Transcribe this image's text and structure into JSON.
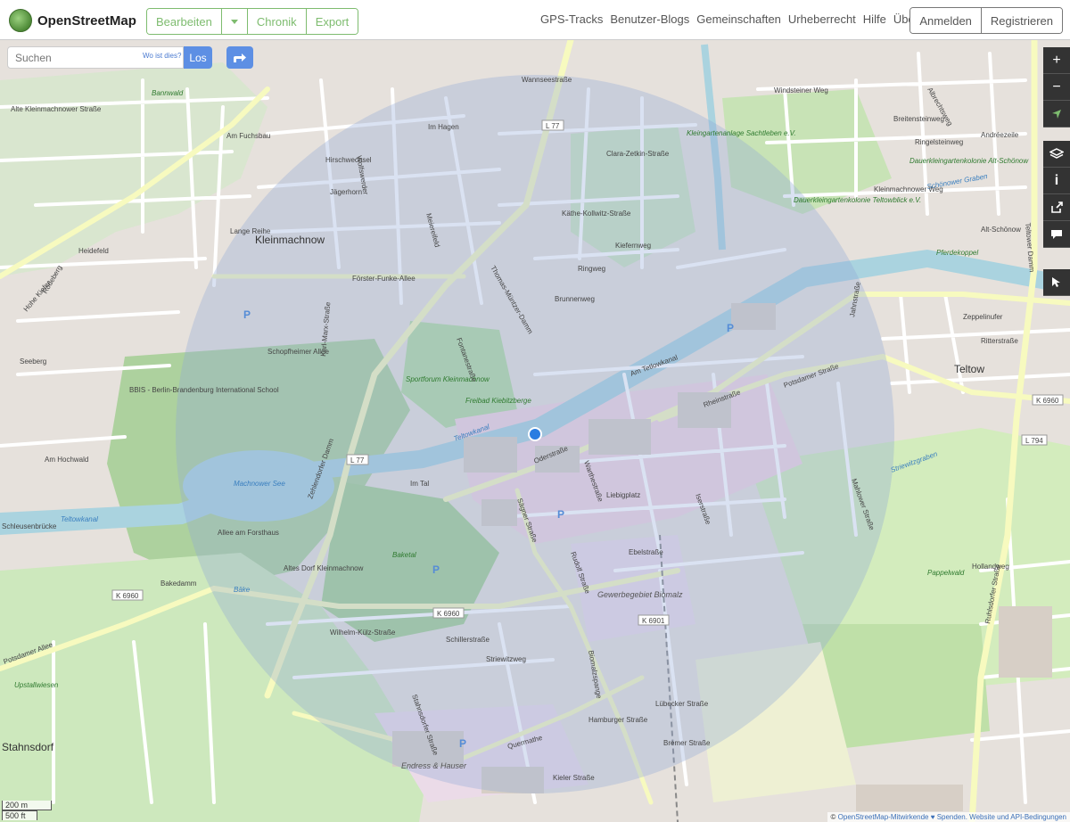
{
  "brand": {
    "name": "OpenStreetMap"
  },
  "edit": {
    "bearbeiten": "Bearbeiten",
    "chronik": "Chronik",
    "export": "Export"
  },
  "nav": [
    "GPS-Tracks",
    "Benutzer-Blogs",
    "Gemeinschaften",
    "Urheberrecht",
    "Hilfe",
    "Über"
  ],
  "auth": {
    "login": "Anmelden",
    "register": "Registrieren"
  },
  "search": {
    "placeholder": "Suchen",
    "where": "Wo ist dies?",
    "go": "Los"
  },
  "scale": {
    "metric": "200 m",
    "imperial": "500 ft"
  },
  "attribution": {
    "copy": "© ",
    "contributors": "OpenStreetMap-Mitwirkende",
    "tail": " ♥ Spenden. Website und API-Bedingungen"
  },
  "controls": [
    "zoom-in",
    "zoom-out",
    "locate",
    "layers",
    "info",
    "share",
    "note",
    "query"
  ],
  "colors": {
    "accent_green": "#7ebc6f",
    "blue": "#5d8fe4",
    "accuracy_circle": "#8ea6d8"
  },
  "map_labels": {
    "towns": [
      "Kleinmachnow",
      "Teltow",
      "Stahnsdorf"
    ],
    "places": [
      "Liebigplatz",
      "Altes Dorf Kleinmachnow",
      "Machnower See",
      "Baketal",
      "Sportforum Kleinmachnow",
      "Freibad Kiebitzberge",
      "BBIS - Berlin-Brandenburg International School",
      "Gewerbegebiet Biomalz",
      "Endress & Hauser",
      "Upstallwiesen",
      "Bannwald",
      "Pappelwald",
      "Schleusenbrücke",
      "Kleingartenanlage Sachtleben e.V.",
      "Dauerkleingartenkolonie Alt-Schönow",
      "Dauerkleingartenkolonie Teltowblick e.V.",
      "Pferdekoppel",
      "Alt-Schönow"
    ],
    "roads": [
      "Zehlendorfer Damm",
      "Förster-Funke-Allee",
      "Oderstraße",
      "Potsdamer Straße",
      "Bakedamm",
      "Potsdamer Allee",
      "Wilhelm-Külz-Straße",
      "Quermathe",
      "Sägner Straße",
      "Rudolf Straße",
      "Biomalzspange",
      "Thomas-Müntzer-Damm",
      "Karl-Marx-Straße",
      "Ruhlsdorfer Straße",
      "Teltower Damm",
      "Zeppelinufer",
      "Hamburger Straße",
      "Kieler Straße",
      "Am Hochwald",
      "Lange Reihe",
      "Heidefeld",
      "Hohe Kiefer",
      "Rodeberg",
      "Am Fuchsbau",
      "Jägerhorn",
      "Hirschwechsel",
      "Wolfswerder",
      "Im Hagen",
      "Meiereifeld",
      "Clara-Zetkin-Straße",
      "Käthe-Kollwitz-Straße",
      "Kiefernweg",
      "Ringweg",
      "Brunnenweg",
      "Am Tetlowkanal",
      "Striewitzweg",
      "Stahnsdorfer Straße",
      "Lübecker Straße",
      "Bremer Straße",
      "Wannseestraße",
      "Mahlower Straße",
      "Iserstraße",
      "Rheinstraße",
      "Warthestraße",
      "Ebelstraße",
      "Schillerstraße",
      "Seeberg",
      "Jahnstraße",
      "Ritterstraße",
      "Hollandweg",
      "Im Tal",
      "Allee am Forsthaus",
      "Schopfheimer Allee",
      "Fontanestraße",
      "Windsteiner Weg",
      "Kleinmachnower Weg",
      "Breitensteinweg",
      "Ringelsteinweg",
      "Andréezeile",
      "Albrechtsweg",
      "Alte Kleinmachnower Straße"
    ],
    "road_refs": [
      "L 77",
      "L 77",
      "K 6960",
      "K 6960",
      "K 6901",
      "K 6960",
      "L 794"
    ],
    "water": [
      "Teltowkanal",
      "Teltowkanal",
      "Schönower Graben",
      "Striewitzgraben",
      "Bäke"
    ]
  }
}
